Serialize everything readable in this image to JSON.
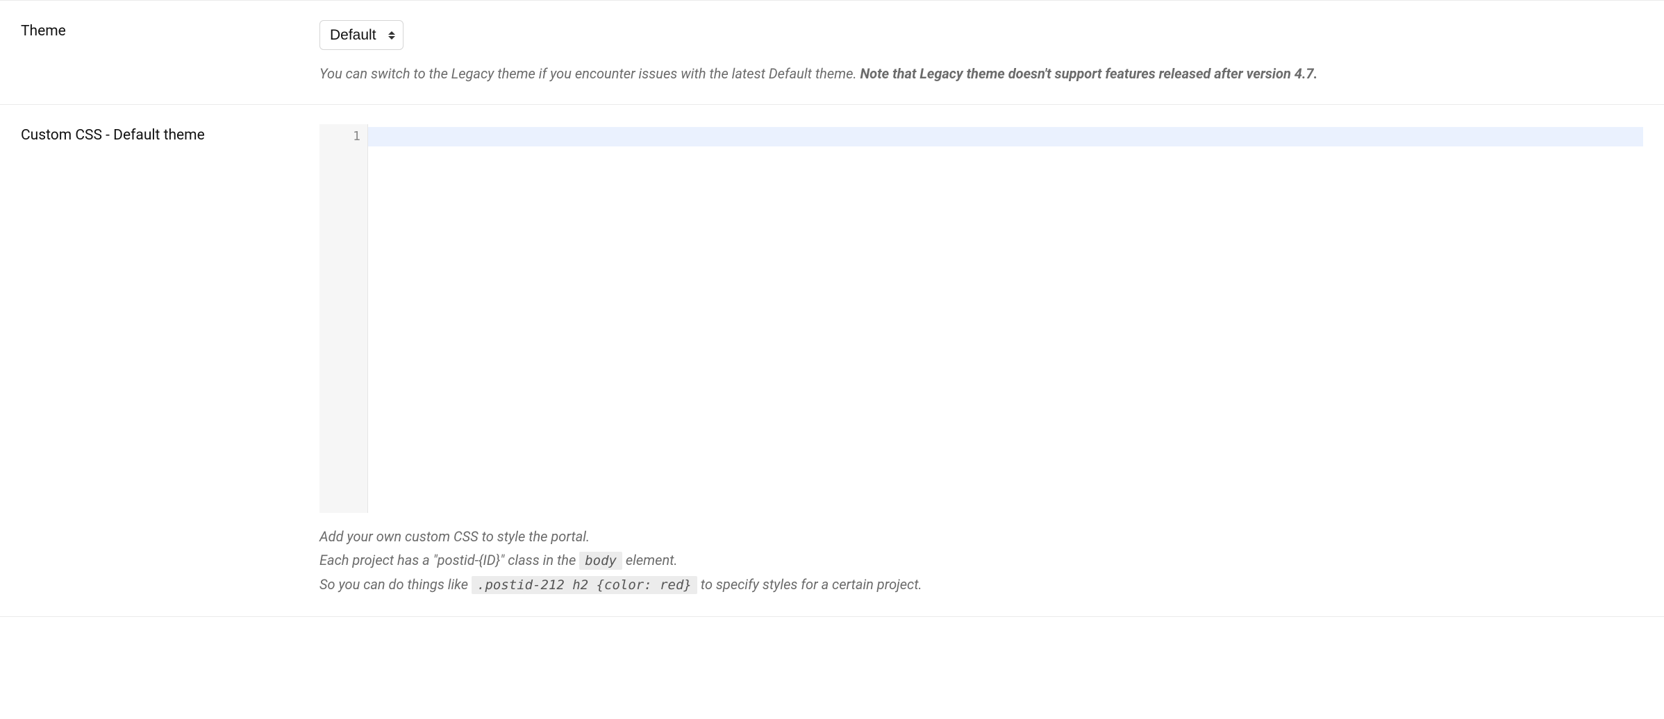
{
  "theme_row": {
    "label": "Theme",
    "selected": "Default",
    "help_plain": "You can switch to the Legacy theme if you encounter issues with the latest Default theme. ",
    "help_strong": "Note that Legacy theme doesn't support features released after version 4.7."
  },
  "css_row": {
    "label": "Custom CSS - Default theme",
    "editor": {
      "line_numbers": [
        "1"
      ],
      "content": ""
    },
    "help": {
      "line1": "Add your own custom CSS to style the portal.",
      "line2_pre": "Each project has a \"postid-{ID}\" class in the ",
      "line2_code": "body",
      "line2_post": " element.",
      "line3_pre": "So you can do things like ",
      "line3_code": ".postid-212 h2 {color: red}",
      "line3_post": " to specify styles for a certain project."
    }
  }
}
